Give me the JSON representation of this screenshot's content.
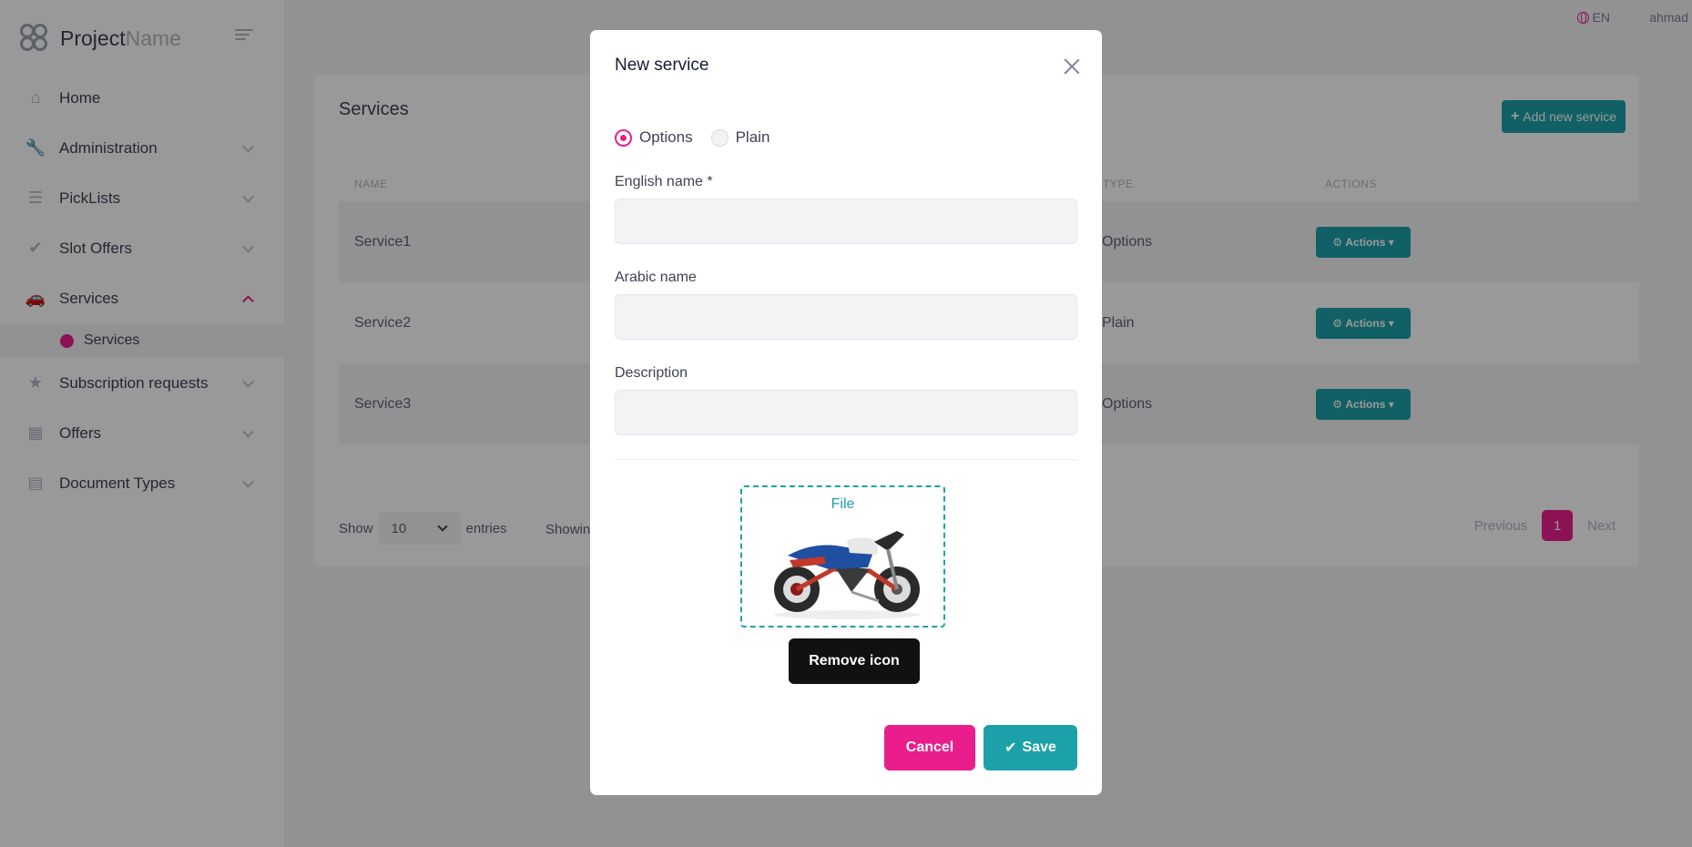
{
  "brand": {
    "name_bold": "Project",
    "name_light": "Name"
  },
  "topbar": {
    "lang": "EN",
    "user": "ahmad"
  },
  "sidebar": {
    "items": [
      {
        "label": "Home",
        "icon": "home-icon",
        "glyph": "⌂",
        "has_chevron": false
      },
      {
        "label": "Administration",
        "icon": "wrench-icon",
        "glyph": "🔧",
        "has_chevron": true
      },
      {
        "label": "PickLists",
        "icon": "list-icon",
        "glyph": "☰",
        "has_chevron": true
      },
      {
        "label": "Slot Offers",
        "icon": "check-icon",
        "glyph": "✔",
        "has_chevron": true
      },
      {
        "label": "Services",
        "icon": "car-icon",
        "glyph": "🚗",
        "has_chevron": true,
        "active": true
      },
      {
        "label": "Subscription requests",
        "icon": "star-icon",
        "glyph": "★",
        "has_chevron": true
      },
      {
        "label": "Offers",
        "icon": "building-icon",
        "glyph": "▦",
        "has_chevron": true
      },
      {
        "label": "Document Types",
        "icon": "document-icon",
        "glyph": "▤",
        "has_chevron": true
      }
    ],
    "sub_item": "Services"
  },
  "page": {
    "title": "Services",
    "add_button": "Add new service",
    "columns": {
      "name": "NAME",
      "type": "TYPE",
      "actions": "ACTIONS"
    },
    "rows": [
      {
        "name": "Service1",
        "type": "Options",
        "action": "Actions"
      },
      {
        "name": "Service2",
        "type": "Plain",
        "action": "Actions"
      },
      {
        "name": "Service3",
        "type": "Options",
        "action": "Actions"
      }
    ],
    "show_label": "Show",
    "entries_value": "10",
    "entries_label": "entries",
    "showing_text": "Showin",
    "pager": {
      "previous": "Previous",
      "current": "1",
      "next": "Next"
    }
  },
  "modal": {
    "title": "New service",
    "radio_options": {
      "option1": "Options",
      "option2": "Plain",
      "selected": "Options"
    },
    "fields": {
      "english_name_label": "English name *",
      "english_name_value": "",
      "arabic_name_label": "Arabic name",
      "arabic_name_value": "",
      "description_label": "Description",
      "description_value": ""
    },
    "file_label": "File",
    "remove_icon_button": "Remove icon",
    "cancel_button": "Cancel",
    "save_button": "Save"
  },
  "colors": {
    "accent": "#e91e8c",
    "primary": "#1da1a8",
    "dark": "#111111"
  }
}
